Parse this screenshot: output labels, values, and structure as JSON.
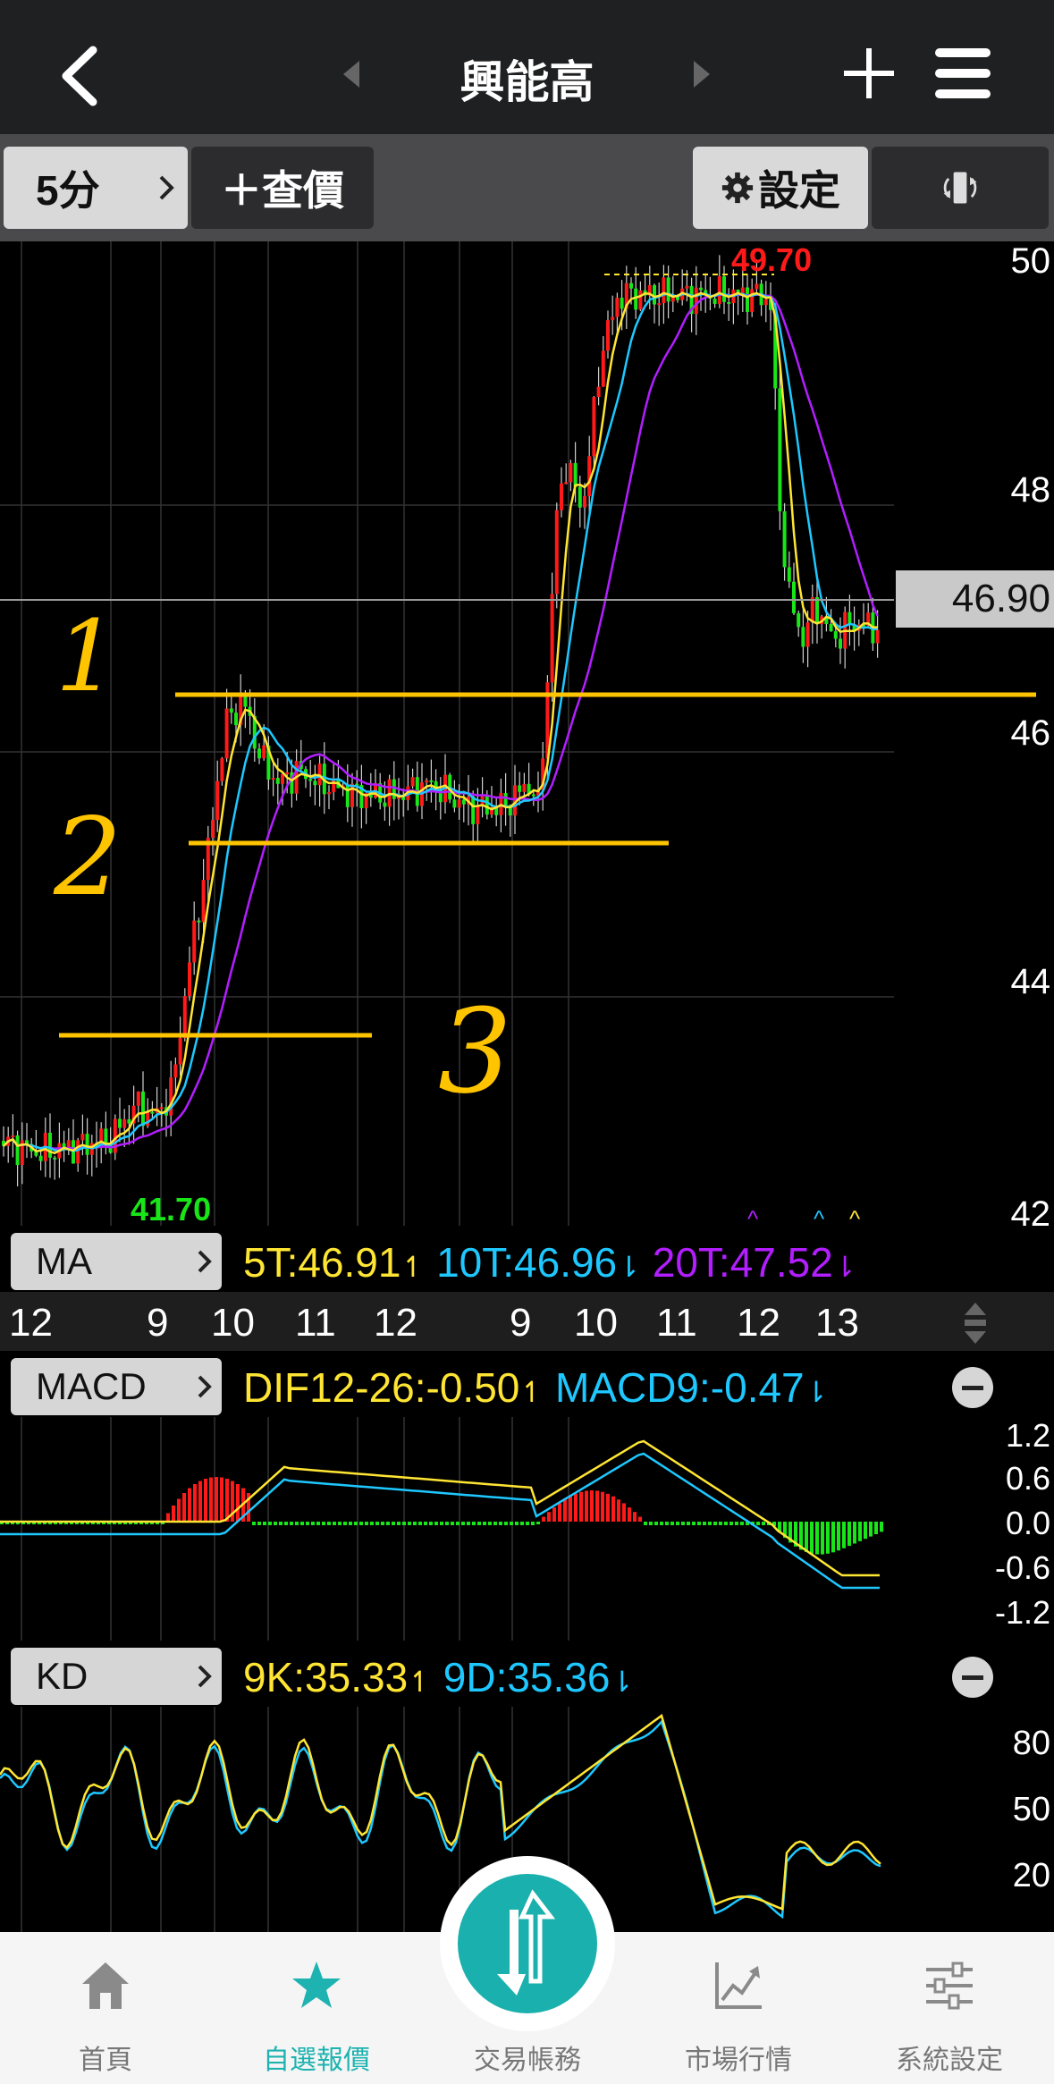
{
  "header": {
    "title": "興能高"
  },
  "toolbar": {
    "interval_label": "5分",
    "query_label": "＋查價",
    "settings_label": "設定"
  },
  "main_chart": {
    "price_ticks": [
      "50",
      "48",
      "46",
      "44",
      "42"
    ],
    "current_price": "46.90",
    "high_label": "49.70",
    "low_label": "41.70",
    "annotations": [
      "1",
      "2",
      "3"
    ],
    "colors": {
      "up": "#ff1a1a",
      "down": "#19e619",
      "ma5": "#ffe533",
      "ma10": "#1ec8ff",
      "ma20": "#b21eff",
      "hline": "#ffc400"
    }
  },
  "ma_bar": {
    "tag": "MA",
    "ma5": "5T:46.91",
    "ma10": "10T:46.96",
    "ma20": "20T:47.52"
  },
  "time_axis": [
    "12",
    "9",
    "10",
    "11",
    "12",
    "9",
    "10",
    "11",
    "12",
    "13"
  ],
  "macd_bar": {
    "tag": "MACD",
    "dif": "DIF12-26:-0.50",
    "macd9": "MACD9:-0.47"
  },
  "macd_ticks": [
    "1.2",
    "0.6",
    "0.0",
    "-0.6",
    "-1.2"
  ],
  "kd_bar": {
    "tag": "KD",
    "k": "9K:35.33",
    "d": "9D:35.36"
  },
  "kd_ticks": [
    "80",
    "50",
    "20"
  ],
  "bottom_nav": {
    "items": [
      {
        "label": "首頁",
        "icon": "home-icon"
      },
      {
        "label": "自選報價",
        "icon": "star-icon"
      },
      {
        "label": "交易帳務",
        "icon": "trade-icon"
      },
      {
        "label": "市場行情",
        "icon": "chart-icon"
      },
      {
        "label": "系統設定",
        "icon": "sliders-icon"
      }
    ],
    "active_color": "#1eb3b0"
  }
}
